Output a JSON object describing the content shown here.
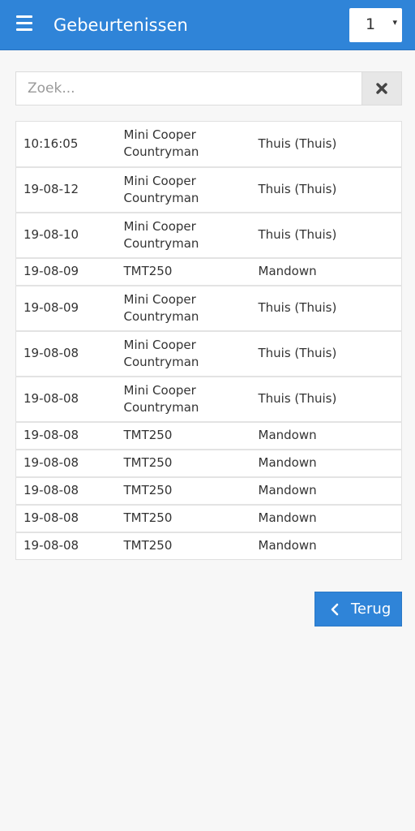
{
  "header": {
    "title": "Gebeurtenissen",
    "menu_icon": "hamburger-icon",
    "page_select": {
      "value": "1",
      "arrow": "▾"
    }
  },
  "search": {
    "placeholder": "Zoek...",
    "value": "",
    "clear_icon": "close-icon"
  },
  "events": [
    {
      "time": "10:16:05",
      "device": "Mini Cooper Countryman",
      "location": "Thuis (Thuis)"
    },
    {
      "time": "19-08-12",
      "device": "Mini Cooper Countryman",
      "location": "Thuis (Thuis)"
    },
    {
      "time": "19-08-10",
      "device": "Mini Cooper Countryman",
      "location": "Thuis (Thuis)"
    },
    {
      "time": "19-08-09",
      "device": "TMT250",
      "location": "Mandown"
    },
    {
      "time": "19-08-09",
      "device": "Mini Cooper Countryman",
      "location": "Thuis (Thuis)"
    },
    {
      "time": "19-08-08",
      "device": "Mini Cooper Countryman",
      "location": "Thuis (Thuis)"
    },
    {
      "time": "19-08-08",
      "device": "Mini Cooper Countryman",
      "location": "Thuis (Thuis)"
    },
    {
      "time": "19-08-08",
      "device": "TMT250",
      "location": "Mandown"
    },
    {
      "time": "19-08-08",
      "device": "TMT250",
      "location": "Mandown"
    },
    {
      "time": "19-08-08",
      "device": "TMT250",
      "location": "Mandown"
    },
    {
      "time": "19-08-08",
      "device": "TMT250",
      "location": "Mandown"
    },
    {
      "time": "19-08-08",
      "device": "TMT250",
      "location": "Mandown"
    }
  ],
  "back_button": {
    "label": "Terug",
    "icon": "chevron-left-icon"
  },
  "colors": {
    "accent": "#2f84d8",
    "background": "#f7f7f7"
  }
}
